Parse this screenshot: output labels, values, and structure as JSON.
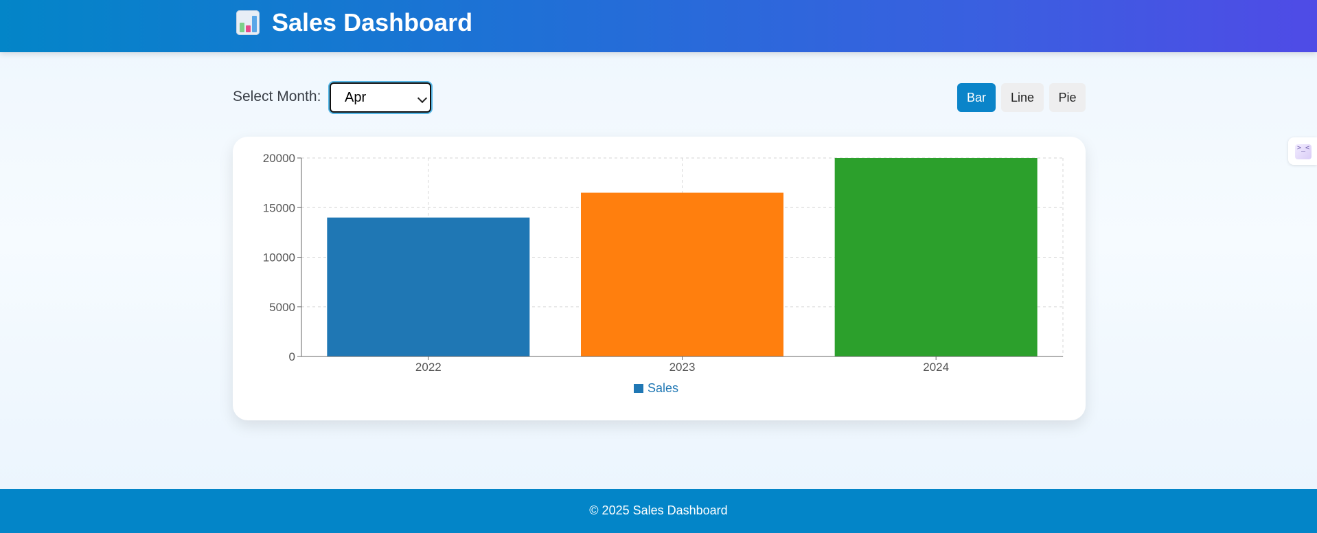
{
  "header": {
    "title": "Sales Dashboard",
    "icon": "bar-chart-icon"
  },
  "controls": {
    "month_label": "Select Month:",
    "month_selected": "Apr",
    "chart_types": [
      "Bar",
      "Line",
      "Pie"
    ],
    "active_chart_type": "Bar"
  },
  "colors": {
    "header_start": "#0385c8",
    "header_end": "#4f4be6",
    "active_button": "#0a84c9",
    "footer": "#0385c8"
  },
  "chart_data": {
    "type": "bar",
    "categories": [
      "2022",
      "2023",
      "2024"
    ],
    "values": [
      14000,
      16500,
      20000
    ],
    "bar_colors": [
      "#1f77b4",
      "#ff7f0e",
      "#2ca02c"
    ],
    "series": [
      {
        "name": "Sales",
        "values": [
          14000,
          16500,
          20000
        ]
      }
    ],
    "yticks": [
      0,
      5000,
      10000,
      15000,
      20000
    ],
    "ylim": [
      0,
      20000
    ],
    "grid": true,
    "legend": "bottom-center"
  },
  "footer": {
    "text": "© 2025 Sales Dashboard"
  },
  "side_tool": {
    "icon": "devtools-icon",
    "glyph": ">_<"
  }
}
